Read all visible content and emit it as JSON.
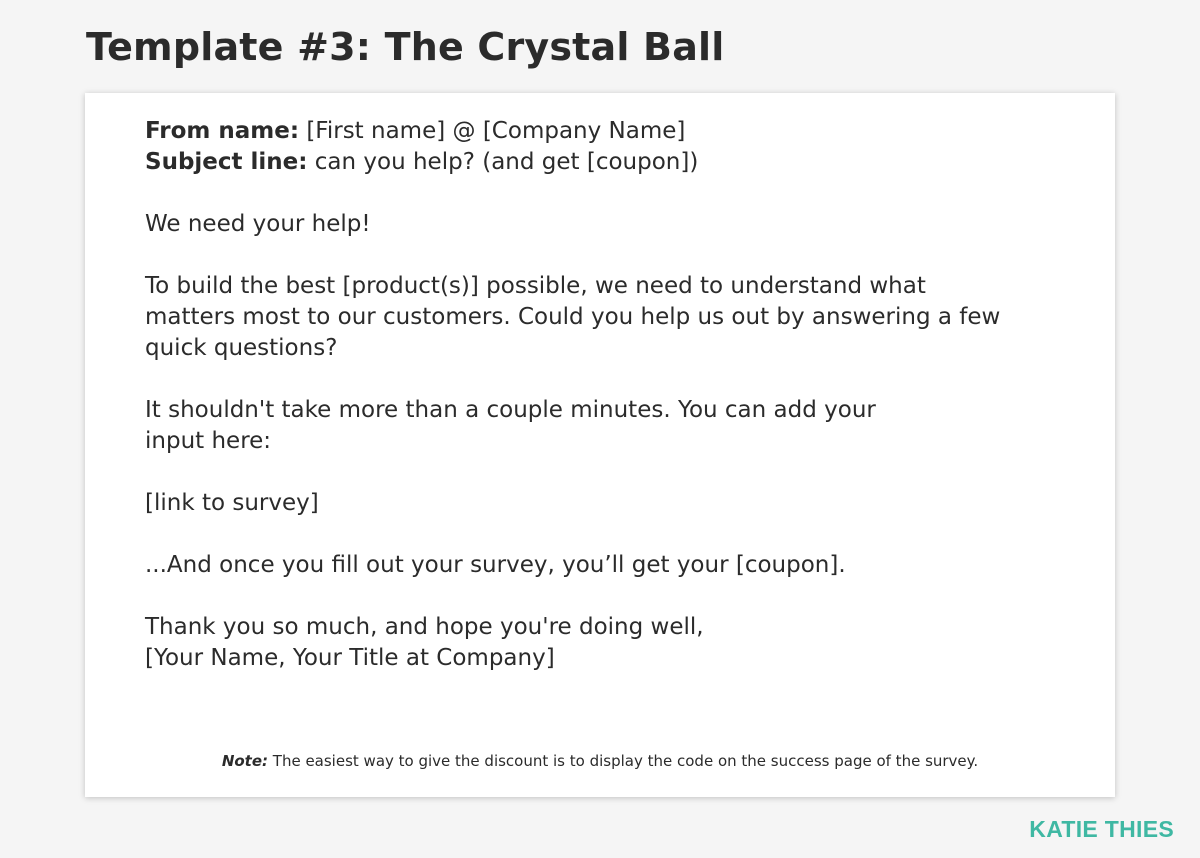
{
  "title": "Template #3: The Crystal Ball",
  "email": {
    "from_label": "From name:",
    "from_value": " [First name] @ [Company Name]",
    "subject_label": "Subject line:",
    "subject_value": " can you help? (and get [coupon])",
    "greeting": "We need your help!",
    "paragraph1_line1": "To build the best [product(s)] possible, we need to understand what",
    "paragraph1_line2": "matters most to our customers. Could you help us out by answering a few",
    "paragraph1_line3": "quick questions?",
    "paragraph2_line1": "It shouldn't take more than a couple minutes. You can add your",
    "paragraph2_line2": "input here:",
    "link": "[link to survey]",
    "paragraph3": "...And once you fill out your survey, you’ll get your [coupon].",
    "closing_line1": "Thank you so much, and hope you're doing well,",
    "closing_line2": "[Your Name, Your Title at Company]"
  },
  "note": {
    "label": "Note:",
    "text": " The easiest way to give the discount is to display the code on the success page of the survey."
  },
  "brand": {
    "name": "KATIE THIES",
    "color": "#3fb8a3"
  }
}
